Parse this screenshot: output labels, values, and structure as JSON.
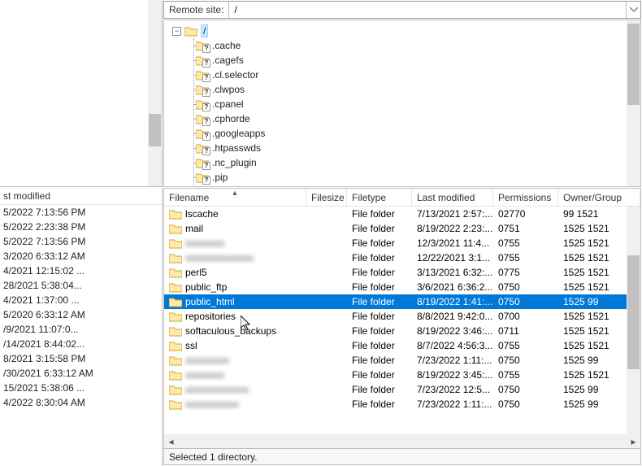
{
  "remote": {
    "label": "Remote site:",
    "path": "/"
  },
  "tree": {
    "root_label": "/",
    "items": [
      ".cache",
      ".cagefs",
      ".cl.selector",
      ".clwpos",
      ".cpanel",
      ".cphorde",
      ".googleapps",
      ".htpasswds",
      ".nc_plugin",
      ".pip"
    ]
  },
  "left_header": "st modified",
  "left_times": [
    "5/2022 7:13:56 PM",
    "5/2022 2:23:38 PM",
    "5/2022 7:13:56 PM",
    "3/2020 6:33:12 AM",
    "4/2021 12:15:02 ...",
    "28/2021 5:38:04...",
    "4/2021 1:37:00 ...",
    "5/2020 6:33:12 AM",
    "/9/2021 11:07:0...",
    "/14/2021 8:44:02...",
    "8/2021 3:15:58 PM",
    "/30/2021 6:33:12 AM",
    "15/2021 5:38:06 ...",
    "4/2022 8:30:04 AM"
  ],
  "columns": {
    "filename": "Filename",
    "filesize": "Filesize",
    "filetype": "Filetype",
    "lastmod": "Last modified",
    "perms": "Permissions",
    "owner": "Owner/Group"
  },
  "files": [
    {
      "name": "lscache",
      "type": "File folder",
      "mod": "7/13/2021 2:57:...",
      "perm": "02770",
      "own": "99 1521"
    },
    {
      "name": "mail",
      "type": "File folder",
      "mod": "8/19/2022 2:23:...",
      "perm": "0751",
      "own": "1525 1521"
    },
    {
      "name": "xxxxxxxx",
      "type": "File folder",
      "mod": "12/3/2021 11:4...",
      "perm": "0755",
      "own": "1525 1521",
      "blur": true
    },
    {
      "name": "xxxxxxxxxxxxxx",
      "type": "File folder",
      "mod": "12/22/2021 3:1...",
      "perm": "0755",
      "own": "1525 1521",
      "blur": true
    },
    {
      "name": "perl5",
      "type": "File folder",
      "mod": "3/13/2021 6:32:...",
      "perm": "0775",
      "own": "1525 1521"
    },
    {
      "name": "public_ftp",
      "type": "File folder",
      "mod": "3/6/2021 6:36:2...",
      "perm": "0750",
      "own": "1525 1521"
    },
    {
      "name": "public_html",
      "type": "File folder",
      "mod": "8/19/2022 1:41:...",
      "perm": "0750",
      "own": "1525 99",
      "selected": true
    },
    {
      "name": "repositories",
      "type": "File folder",
      "mod": "8/8/2021 9:42:0...",
      "perm": "0700",
      "own": "1525 1521"
    },
    {
      "name": "softaculous_backups",
      "type": "File folder",
      "mod": "8/19/2022 3:46:...",
      "perm": "0711",
      "own": "1525 1521"
    },
    {
      "name": "ssl",
      "type": "File folder",
      "mod": "8/7/2022 4:56:3...",
      "perm": "0755",
      "own": "1525 1521"
    },
    {
      "name": "xxxxxxxxx",
      "type": "File folder",
      "mod": "7/23/2022 1:11:...",
      "perm": "0750",
      "own": "1525 99",
      "blur": true
    },
    {
      "name": "xxxxxxxx",
      "type": "File folder",
      "mod": "8/19/2022 3:45:...",
      "perm": "0755",
      "own": "1525 1521",
      "blur": true
    },
    {
      "name": "xxxxxxxxxxxxx",
      "type": "File folder",
      "mod": "7/23/2022 12:5...",
      "perm": "0750",
      "own": "1525 99",
      "blur": true
    },
    {
      "name": "xxxxxxxxxxx",
      "type": "File folder",
      "mod": "7/23/2022 1:11:...",
      "perm": "0750",
      "own": "1525 99",
      "blur": true
    }
  ],
  "status": "Selected 1 directory.",
  "colors": {
    "selection": "#0078d7",
    "folder": "#ffe9a6",
    "folder_stroke": "#c9a93f"
  }
}
